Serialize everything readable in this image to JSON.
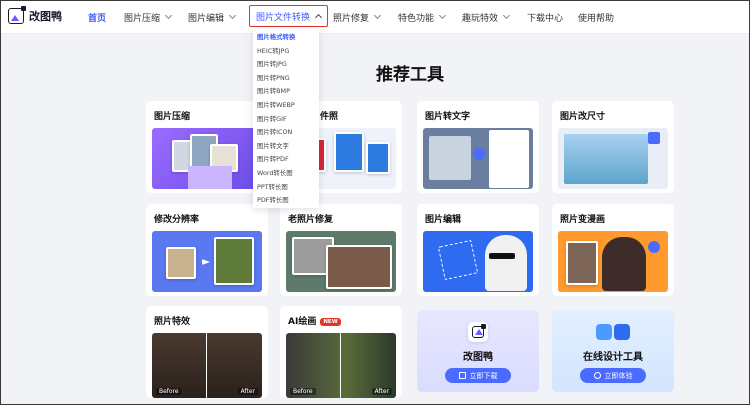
{
  "logo": {
    "text": "改图鸭"
  },
  "nav": {
    "home": "首页",
    "compress": "图片压缩",
    "edit": "图片编辑",
    "convert": "图片文件转换",
    "repair": "照片修复",
    "features": "特色功能",
    "fun": "趣玩特效",
    "fun_badge": "",
    "download": "下载中心",
    "help": "使用帮助"
  },
  "dropdown": [
    "图片格式转换",
    "HEIC转JPG",
    "图片转JPG",
    "图片转PNG",
    "图片转BMP",
    "图片转WEBP",
    "图片转GIF",
    "图片转ICON",
    "图片转文字",
    "图片转PDF",
    "Word转长图",
    "PPT转长图",
    "PDF转长图"
  ],
  "heading": "推荐工具",
  "cards": {
    "c1": "图片压缩",
    "c2": "件照",
    "c3": "图片转文字",
    "c4": "图片改尺寸",
    "c5": "修改分辨率",
    "c6": "老照片修复",
    "c7": "图片编辑",
    "c8": "照片变漫画",
    "c9": "照片特效",
    "c10": "AI绘画",
    "c10_badge": "NEW"
  },
  "labels": {
    "before": "Before",
    "after": "After"
  },
  "promo": {
    "app_title": "改图鸭",
    "app_btn": "立即下载",
    "design_title": "在线设计工具",
    "design_btn": "立即体验"
  },
  "colors": {
    "accent": "#3e5bff",
    "badge": "#e0352b",
    "button": "#4b6bff"
  }
}
